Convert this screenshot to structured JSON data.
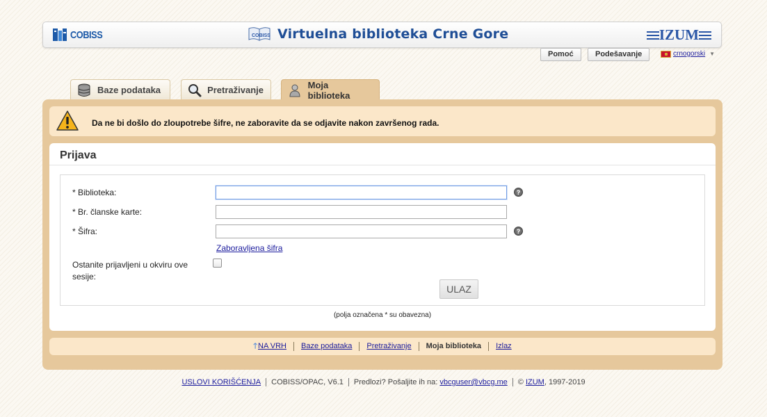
{
  "header": {
    "cobiss_logo_text": "COBISS",
    "title": "Virtuelna biblioteka Crne Gore",
    "izum_logo_text": "IZUM"
  },
  "top_buttons": {
    "help": "Pomoć",
    "settings": "Podešavanje",
    "language": "crnogorski"
  },
  "tabs": [
    {
      "label": "Baze podataka",
      "icon": "database-icon",
      "active": false
    },
    {
      "label": "Pretraživanje",
      "icon": "magnifier-icon",
      "active": false
    },
    {
      "label": "Moja biblioteka",
      "icon": "user-icon",
      "active": true
    }
  ],
  "warning": {
    "icon": "warning-icon",
    "text": "Da ne bi došlo do zloupotrebe šifre, ne zaboravite da se odjavite nakon završenog rada."
  },
  "login": {
    "title": "Prijava",
    "fields": [
      {
        "label": "* Biblioteka:",
        "value": "",
        "has_help": true
      },
      {
        "label": "* Br. članske karte:",
        "value": "",
        "has_help": false
      },
      {
        "label": "* Šifra:",
        "value": "",
        "has_help": true
      }
    ],
    "help_glyph": "?",
    "forgot_link": "Zaboravljena šifra",
    "remember_label": "Ostanite prijavljeni u okviru ove sesije:",
    "remember_checked": false,
    "submit": "ULAZ",
    "mandatory_note": "(polja označena * su obavezna)"
  },
  "bottom_nav": {
    "top_arrow": "🡑",
    "top": "NA VRH",
    "databases": "Baze podataka",
    "search": "Pretraživanje",
    "my_library": "Moja biblioteka",
    "exit": "Izlaz"
  },
  "footer": {
    "terms": "USLOVI KORIŠĆENJA",
    "version": "COBISS/OPAC, V6.1",
    "suggest_text": "Predlozi? Pošaljite ih na:",
    "email": "vbcguser@vbcg.me",
    "copyright_symbol": "©",
    "izum_link": "IZUM",
    "years": ", 1997-2019"
  },
  "colors": {
    "panel": "#e6c89c",
    "panel_light": "#fbe7c9",
    "link": "#1a1a9c",
    "title_blue": "#1f4e96"
  }
}
